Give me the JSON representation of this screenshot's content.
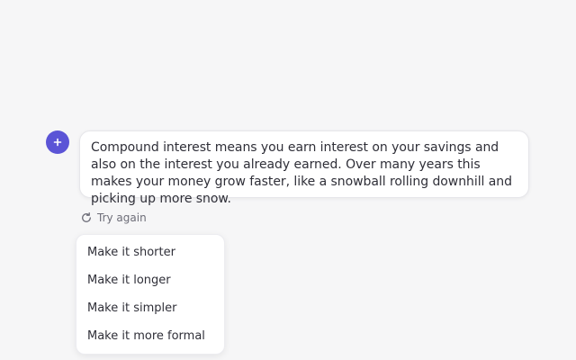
{
  "assistant": {
    "avatar_icon": "sparkle-icon",
    "avatar_color": "#5b54d6",
    "message": "Compound interest means you earn interest on your savings and also on the interest you already earned. Over many years this makes your money grow faster, like a snowball rolling downhill and picking up more snow."
  },
  "actions": {
    "retry_icon": "refresh-icon",
    "retry_label": "Try again"
  },
  "rewrite_menu": {
    "items": [
      {
        "label": "Make it shorter"
      },
      {
        "label": "Make it longer"
      },
      {
        "label": "Make it simpler"
      },
      {
        "label": "Make it more formal"
      }
    ]
  }
}
